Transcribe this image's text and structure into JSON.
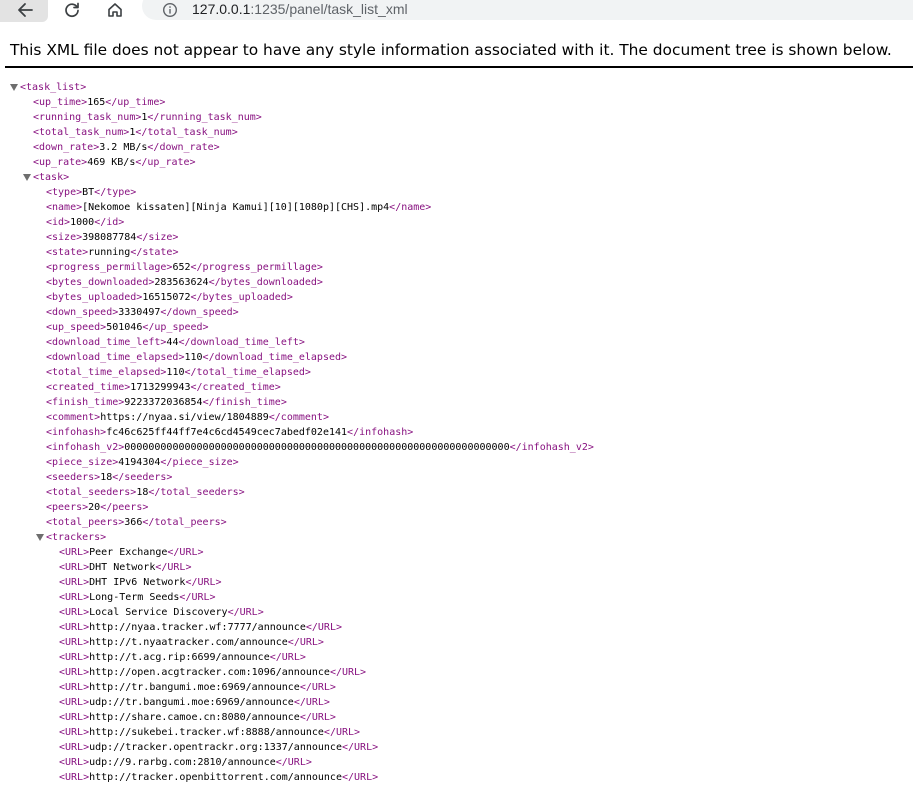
{
  "browser": {
    "url_host": "127.0.0.1",
    "url_rest": ":1235/panel/task_list_xml"
  },
  "icons": {
    "back": "arrow-left-icon",
    "reload": "reload-icon",
    "home": "home-icon",
    "info": "site-info-icon"
  },
  "viewer": {
    "message": "This XML file does not appear to have any style information associated with it. The document tree is shown below."
  },
  "xml_lines": [
    {
      "d": 0,
      "o": "<task_list>",
      "v": "",
      "c": "",
      "t": true
    },
    {
      "d": 1,
      "o": "<up_time>",
      "v": "165",
      "c": "</up_time>"
    },
    {
      "d": 1,
      "o": "<running_task_num>",
      "v": "1",
      "c": "</running_task_num>"
    },
    {
      "d": 1,
      "o": "<total_task_num>",
      "v": "1",
      "c": "</total_task_num>"
    },
    {
      "d": 1,
      "o": "<down_rate>",
      "v": "3.2 MB/s",
      "c": "</down_rate>"
    },
    {
      "d": 1,
      "o": "<up_rate>",
      "v": "469 KB/s",
      "c": "</up_rate>"
    },
    {
      "d": 1,
      "o": "<task>",
      "v": "",
      "c": "",
      "t": true
    },
    {
      "d": 2,
      "o": "<type>",
      "v": "BT",
      "c": "</type>"
    },
    {
      "d": 2,
      "o": "<name>",
      "v": "[Nekomoe kissaten][Ninja Kamui][10][1080p][CHS].mp4",
      "c": "</name>"
    },
    {
      "d": 2,
      "o": "<id>",
      "v": "1000",
      "c": "</id>"
    },
    {
      "d": 2,
      "o": "<size>",
      "v": "398087784",
      "c": "</size>"
    },
    {
      "d": 2,
      "o": "<state>",
      "v": "running",
      "c": "</state>"
    },
    {
      "d": 2,
      "o": "<progress_permillage>",
      "v": "652",
      "c": "</progress_permillage>"
    },
    {
      "d": 2,
      "o": "<bytes_downloaded>",
      "v": "283563624",
      "c": "</bytes_downloaded>"
    },
    {
      "d": 2,
      "o": "<bytes_uploaded>",
      "v": "16515072",
      "c": "</bytes_uploaded>"
    },
    {
      "d": 2,
      "o": "<down_speed>",
      "v": "3330497",
      "c": "</down_speed>"
    },
    {
      "d": 2,
      "o": "<up_speed>",
      "v": "501046",
      "c": "</up_speed>"
    },
    {
      "d": 2,
      "o": "<download_time_left>",
      "v": "44",
      "c": "</download_time_left>"
    },
    {
      "d": 2,
      "o": "<download_time_elapsed>",
      "v": "110",
      "c": "</download_time_elapsed>"
    },
    {
      "d": 2,
      "o": "<total_time_elapsed>",
      "v": "110",
      "c": "</total_time_elapsed>"
    },
    {
      "d": 2,
      "o": "<created_time>",
      "v": "1713299943",
      "c": "</created_time>"
    },
    {
      "d": 2,
      "o": "<finish_time>",
      "v": "9223372036854",
      "c": "</finish_time>"
    },
    {
      "d": 2,
      "o": "<comment>",
      "v": "https://nyaa.si/view/1804889",
      "c": "</comment>"
    },
    {
      "d": 2,
      "o": "<infohash>",
      "v": "fc46c625ff44ff7e4c6cd4549cec7abedf02e141",
      "c": "</infohash>"
    },
    {
      "d": 2,
      "o": "<infohash_v2>",
      "v": "0000000000000000000000000000000000000000000000000000000000000000",
      "c": "</infohash_v2>"
    },
    {
      "d": 2,
      "o": "<piece_size>",
      "v": "4194304",
      "c": "</piece_size>"
    },
    {
      "d": 2,
      "o": "<seeders>",
      "v": "18",
      "c": "</seeders>"
    },
    {
      "d": 2,
      "o": "<total_seeders>",
      "v": "18",
      "c": "</total_seeders>"
    },
    {
      "d": 2,
      "o": "<peers>",
      "v": "20",
      "c": "</peers>"
    },
    {
      "d": 2,
      "o": "<total_peers>",
      "v": "366",
      "c": "</total_peers>"
    },
    {
      "d": 2,
      "o": "<trackers>",
      "v": "",
      "c": "",
      "t": true
    },
    {
      "d": 3,
      "o": "<URL>",
      "v": "Peer Exchange",
      "c": "</URL>"
    },
    {
      "d": 3,
      "o": "<URL>",
      "v": "DHT Network",
      "c": "</URL>"
    },
    {
      "d": 3,
      "o": "<URL>",
      "v": "DHT IPv6 Network",
      "c": "</URL>"
    },
    {
      "d": 3,
      "o": "<URL>",
      "v": "Long-Term Seeds",
      "c": "</URL>"
    },
    {
      "d": 3,
      "o": "<URL>",
      "v": "Local Service Discovery",
      "c": "</URL>"
    },
    {
      "d": 3,
      "o": "<URL>",
      "v": "http://nyaa.tracker.wf:7777/announce",
      "c": "</URL>"
    },
    {
      "d": 3,
      "o": "<URL>",
      "v": "http://t.nyaatracker.com/announce",
      "c": "</URL>"
    },
    {
      "d": 3,
      "o": "<URL>",
      "v": "http://t.acg.rip:6699/announce",
      "c": "</URL>"
    },
    {
      "d": 3,
      "o": "<URL>",
      "v": "http://open.acgtracker.com:1096/announce",
      "c": "</URL>"
    },
    {
      "d": 3,
      "o": "<URL>",
      "v": "http://tr.bangumi.moe:6969/announce",
      "c": "</URL>"
    },
    {
      "d": 3,
      "o": "<URL>",
      "v": "udp://tr.bangumi.moe:6969/announce",
      "c": "</URL>"
    },
    {
      "d": 3,
      "o": "<URL>",
      "v": "http://share.camoe.cn:8080/announce",
      "c": "</URL>"
    },
    {
      "d": 3,
      "o": "<URL>",
      "v": "http://sukebei.tracker.wf:8888/announce",
      "c": "</URL>"
    },
    {
      "d": 3,
      "o": "<URL>",
      "v": "udp://tracker.opentrackr.org:1337/announce",
      "c": "</URL>"
    },
    {
      "d": 3,
      "o": "<URL>",
      "v": "udp://9.rarbg.com:2810/announce",
      "c": "</URL>"
    },
    {
      "d": 3,
      "o": "<URL>",
      "v": "http://tracker.openbittorrent.com/announce",
      "c": "</URL>"
    }
  ]
}
